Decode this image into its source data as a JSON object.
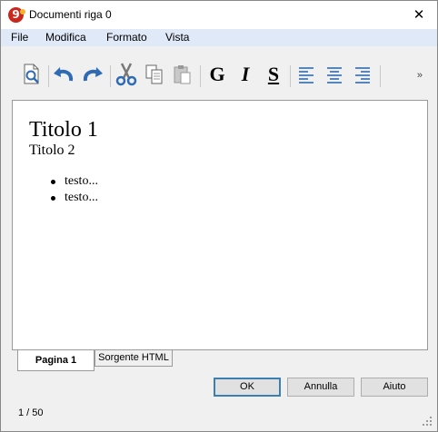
{
  "window": {
    "title": "Documenti riga 0",
    "close_icon": "close-icon"
  },
  "menu": [
    "File",
    "Modifica",
    "Formato",
    "Vista"
  ],
  "toolbar": {
    "icons": [
      "print-preview-icon",
      "undo-icon",
      "redo-icon",
      "cut-icon",
      "copy-icon",
      "paste-icon",
      "align-left-icon",
      "align-center-icon",
      "align-right-icon"
    ],
    "bold_label": "G",
    "italic_label": "I",
    "underline_label": "S",
    "more_label": "»"
  },
  "document": {
    "heading1": "Titolo 1",
    "heading2": "Titolo 2",
    "bullets": [
      "testo...",
      "testo..."
    ]
  },
  "tabs": [
    {
      "label": "Pagina 1",
      "active": true
    },
    {
      "label": "Sorgente HTML",
      "active": false
    }
  ],
  "buttons": {
    "ok": "OK",
    "cancel": "Annulla",
    "help": "Aiuto"
  },
  "status": {
    "page": "1 / 50"
  },
  "colors": {
    "accent_blue": "#2f6bb5",
    "menubar": "#dfe9f7",
    "app_icon": "#c8281e"
  }
}
